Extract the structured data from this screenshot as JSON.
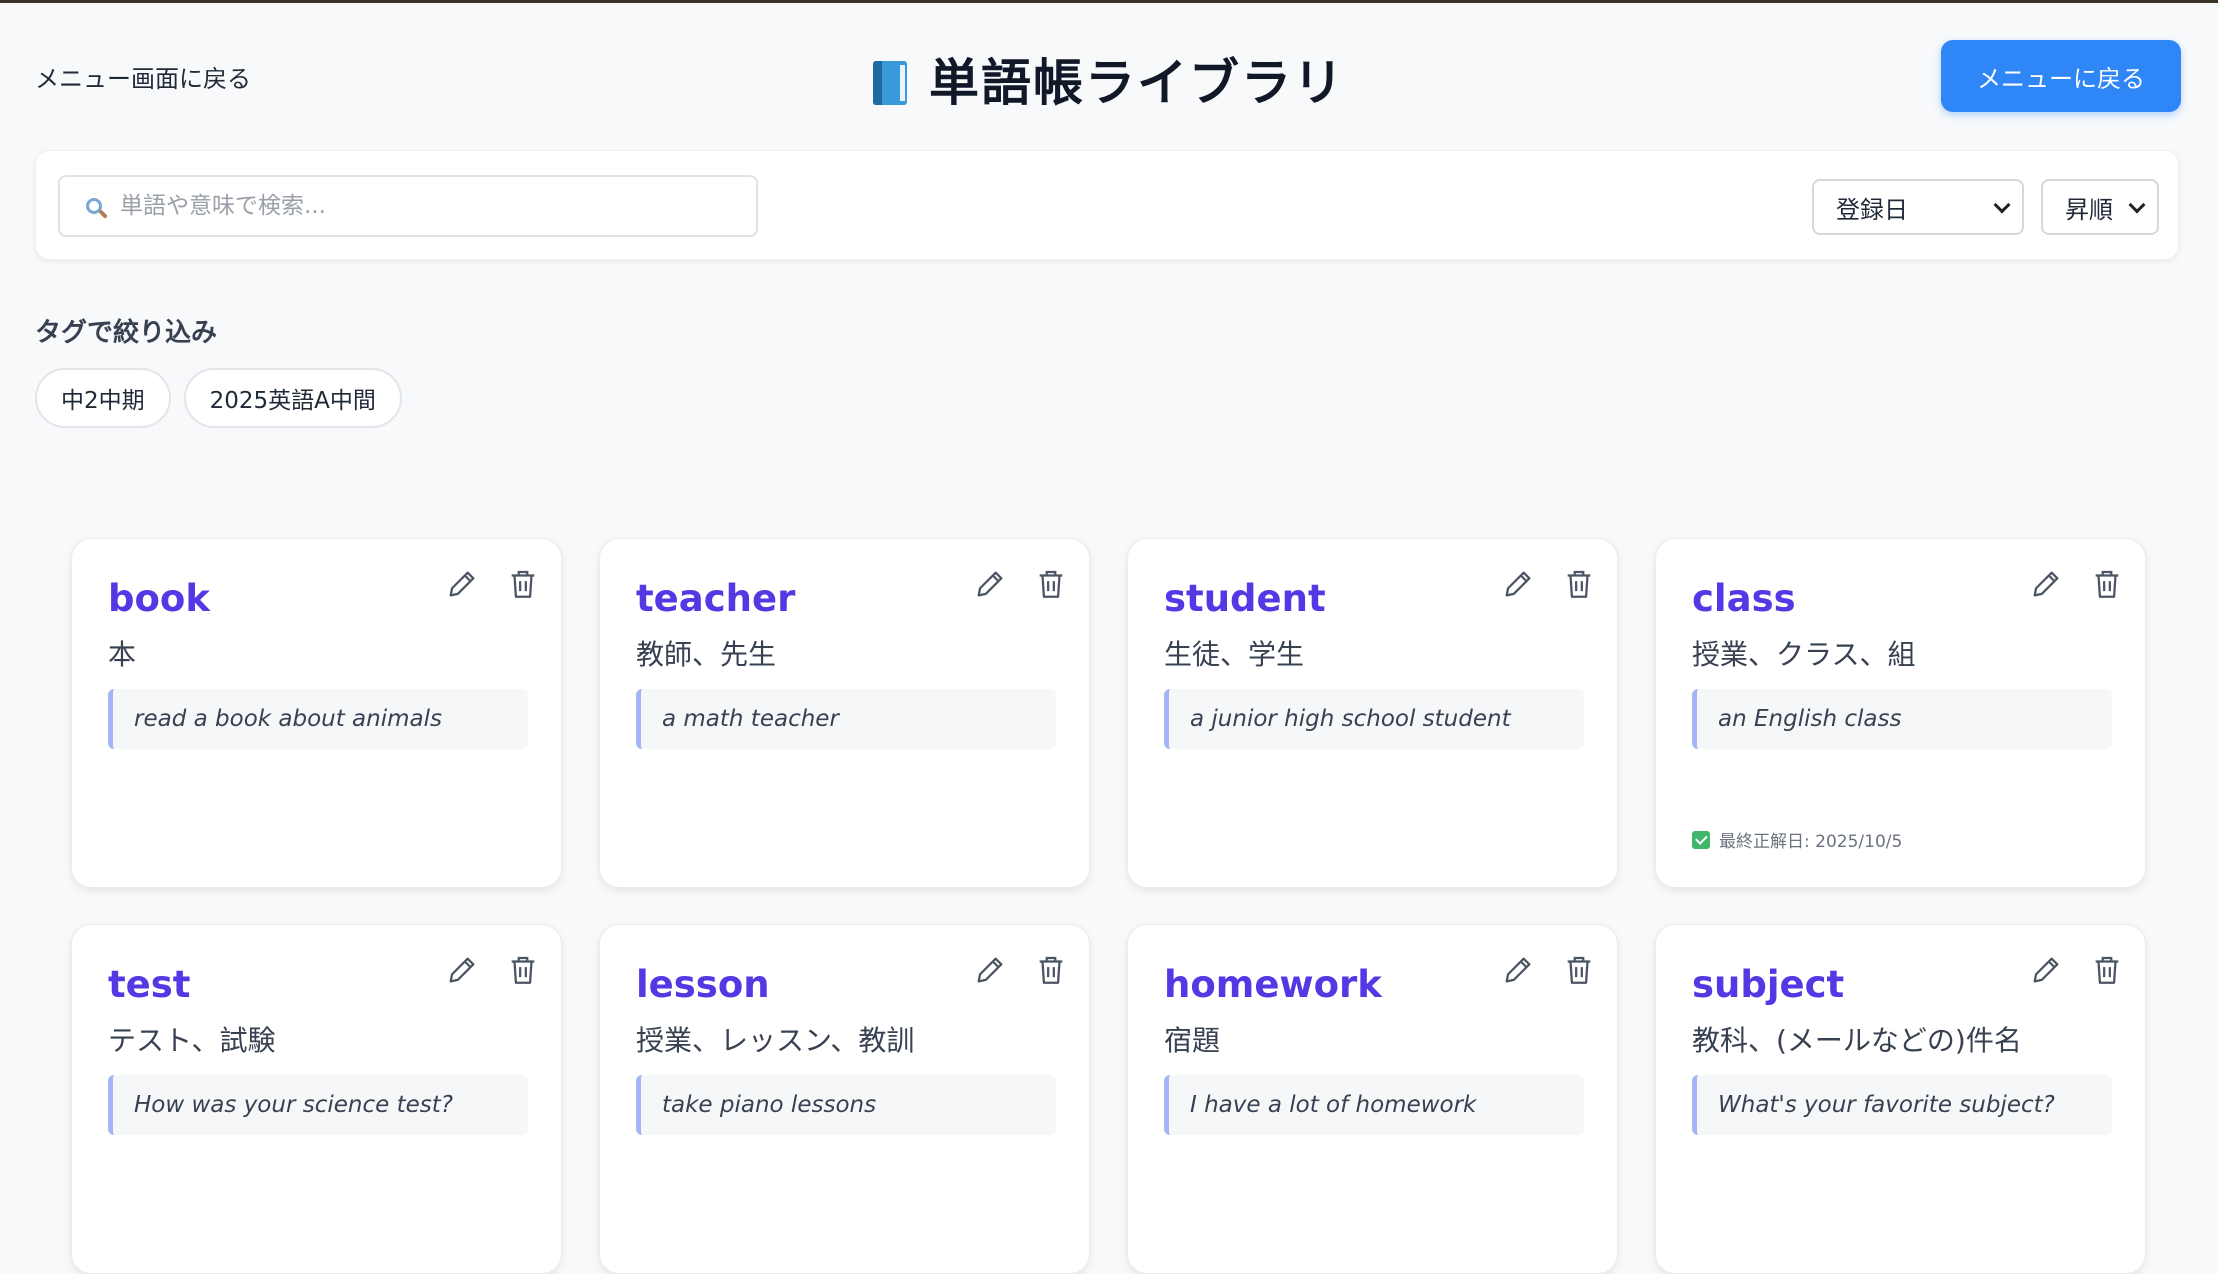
{
  "header": {
    "back_link": "メニュー画面に戻る",
    "title": "単語帳ライブラリ",
    "title_icon": "blue-book-icon",
    "menu_button": "メニューに戻る"
  },
  "search": {
    "placeholder": "単語や意味で検索...",
    "value": ""
  },
  "sort": {
    "field": "登録日",
    "order": "昇順"
  },
  "tags": {
    "heading": "タグで絞り込み",
    "items": [
      "中2中期",
      "2025英語A中間"
    ]
  },
  "cards": [
    {
      "word": "book",
      "meaning": "本",
      "example": "read a book about animals",
      "last_correct": ""
    },
    {
      "word": "teacher",
      "meaning": "教師、先生",
      "example": "a math teacher",
      "last_correct": ""
    },
    {
      "word": "student",
      "meaning": "生徒、学生",
      "example": "a junior high school student",
      "last_correct": ""
    },
    {
      "word": "class",
      "meaning": "授業、クラス、組",
      "example": "an English class",
      "last_correct": "最終正解日: 2025/10/5"
    },
    {
      "word": "test",
      "meaning": "テスト、試験",
      "example": "How was your science test?",
      "last_correct": ""
    },
    {
      "word": "lesson",
      "meaning": "授業、レッスン、教訓",
      "example": "take piano lessons",
      "last_correct": ""
    },
    {
      "word": "homework",
      "meaning": "宿題",
      "example": "I have a lot of homework",
      "last_correct": ""
    },
    {
      "word": "subject",
      "meaning": "教科、(メールなどの)件名",
      "example": "What's your favorite subject?",
      "last_correct": ""
    }
  ],
  "colors": {
    "accent": "#2f86f6",
    "word": "#5438e3",
    "check": "#3fb66a"
  }
}
